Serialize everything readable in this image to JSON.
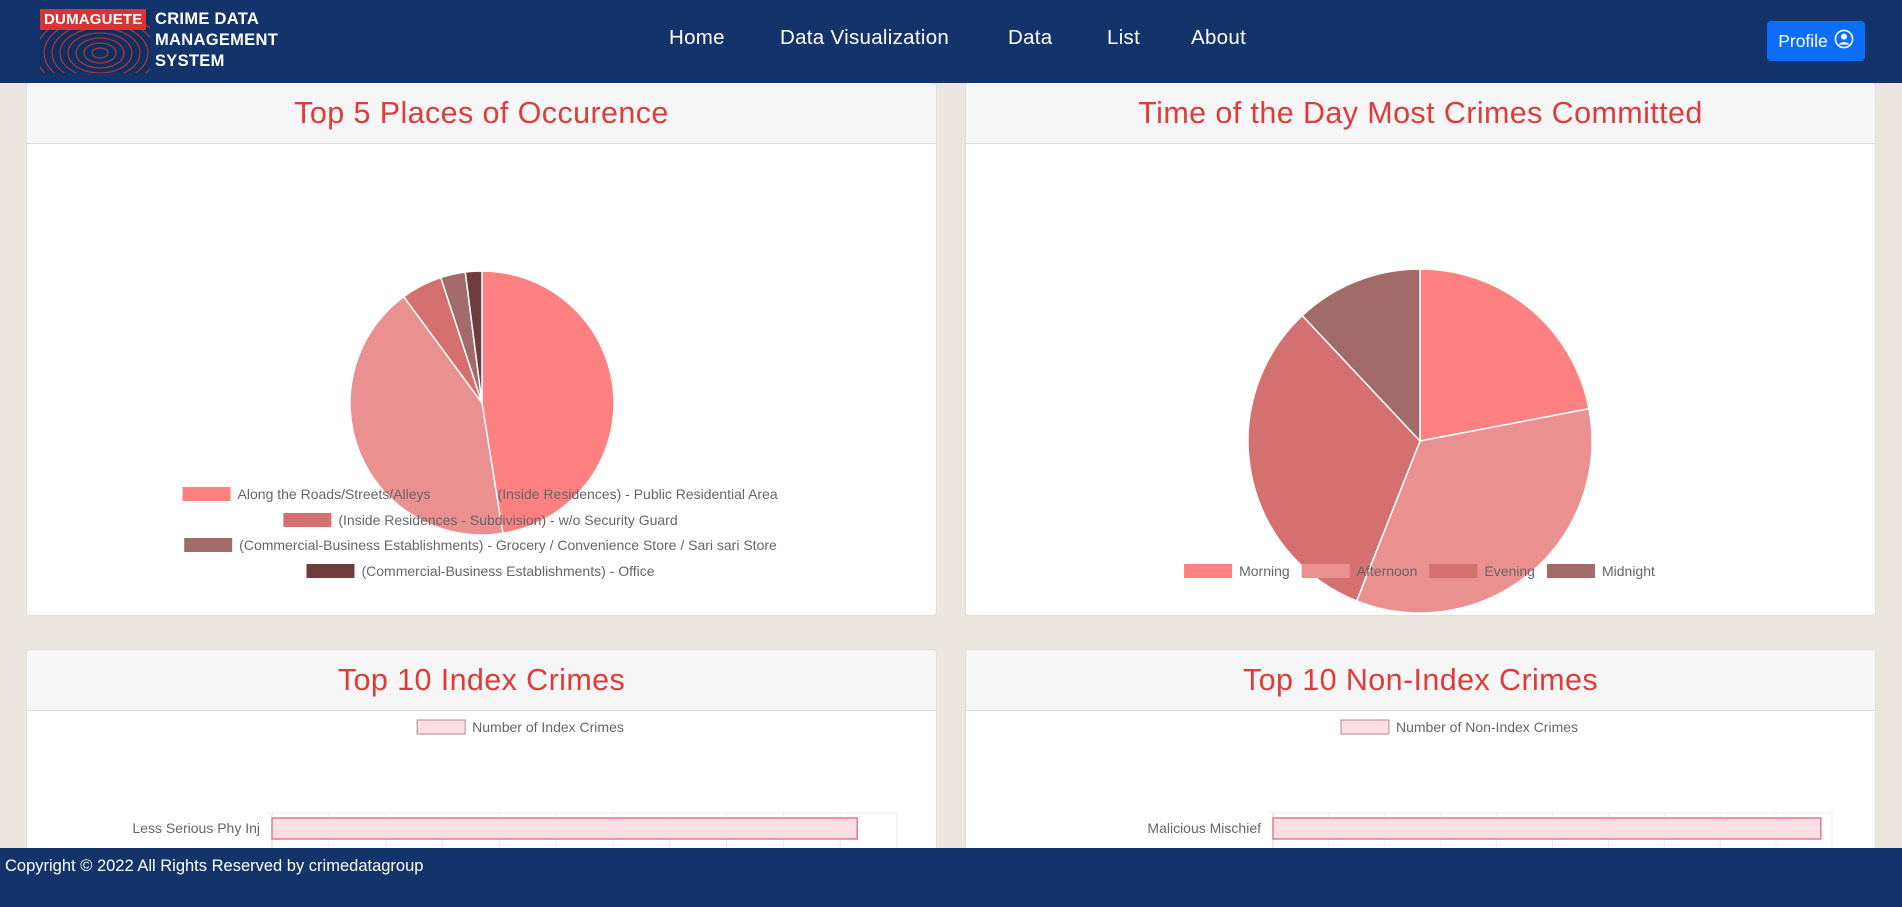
{
  "brand": {
    "badge": "DUMAGUETE",
    "line1": "CRIME DATA",
    "line2": "MANAGEMENT",
    "line3": "SYSTEM"
  },
  "nav": {
    "items": [
      "Home",
      "Data Visualization",
      "Data",
      "List",
      "About"
    ],
    "profile_label": "Profile"
  },
  "colors": {
    "nav_bg": "#12346a",
    "title_red": "#dc3c3a",
    "profile_blue": "#0d6efd",
    "slice_1": "#ff8080",
    "slice_2": "#eb9090",
    "slice_3": "#d47070",
    "slice_4": "#a36a6a",
    "slice_5": "#6e3c3c"
  },
  "cards": {
    "places": {
      "title": "Top 5 Places of Occurence"
    },
    "time": {
      "title": "Time of the Day Most Crimes Committed"
    },
    "index": {
      "title": "Top 10 Index Crimes"
    },
    "nonindex": {
      "title": "Top 10 Non-Index Crimes"
    }
  },
  "chart_data": [
    {
      "type": "pie",
      "title": "Top 5 Places of Occurence",
      "labels": [
        "Along the Roads/Streets/Alleys",
        "(Inside Residences) - Public Residential Area",
        "(Inside Residences - Subdivision) - w/o Security Guard",
        "(Commercial-Business Establishments) - Grocery / Convenience Store / Sari sari Store",
        "(Commercial-Business Establishments) - Office"
      ],
      "values": [
        47,
        42,
        5,
        3,
        2
      ],
      "legend": "bottom"
    },
    {
      "type": "pie",
      "title": "Time of the Day Most Crimes Committed",
      "labels": [
        "Morning",
        "Afternoon",
        "Evening",
        "Midnight"
      ],
      "values": [
        22,
        34,
        32,
        12
      ],
      "legend": "bottom"
    },
    {
      "type": "bar",
      "orientation": "horizontal",
      "title": "Top 10 Index Crimes",
      "series": [
        {
          "name": "Number of Index Crimes"
        }
      ],
      "categories": [
        "Less Serious Phy Inj"
      ],
      "values": [
        10.3
      ],
      "xlim": [
        0,
        11
      ],
      "legend": "top"
    },
    {
      "type": "bar",
      "orientation": "horizontal",
      "title": "Top 10 Non-Index Crimes",
      "series": [
        {
          "name": "Number of Non-Index Crimes"
        }
      ],
      "categories": [
        "Malicious Mischief"
      ],
      "values": [
        9.8
      ],
      "xlim": [
        0,
        10
      ],
      "legend": "top"
    }
  ],
  "footer": {
    "copyright": "Copyright © 2022 All Rights Reserved by crimedatagroup"
  }
}
